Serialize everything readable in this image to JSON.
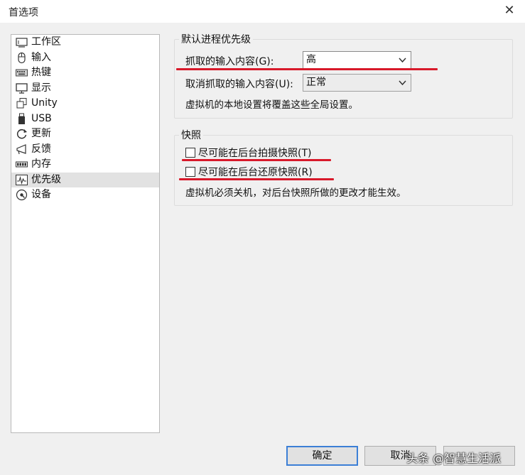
{
  "window": {
    "title": "首选项"
  },
  "sidebar": {
    "items": [
      {
        "label": "工作区",
        "icon": "workspace-icon"
      },
      {
        "label": "输入",
        "icon": "mouse-icon"
      },
      {
        "label": "热键",
        "icon": "keyboard-icon"
      },
      {
        "label": "显示",
        "icon": "monitor-icon"
      },
      {
        "label": "Unity",
        "icon": "unity-icon"
      },
      {
        "label": "USB",
        "icon": "usb-icon"
      },
      {
        "label": "更新",
        "icon": "update-icon"
      },
      {
        "label": "反馈",
        "icon": "feedback-icon"
      },
      {
        "label": "内存",
        "icon": "memory-icon"
      },
      {
        "label": "优先级",
        "icon": "priority-icon"
      },
      {
        "label": "设备",
        "icon": "device-icon"
      }
    ],
    "selected": "优先级"
  },
  "priority": {
    "legend": "默认进程优先级",
    "grabbed_label": "抓取的输入内容(G):",
    "grabbed_value": "高",
    "ungrabbed_label": "取消抓取的输入内容(U):",
    "ungrabbed_value": "正常",
    "note": "虚拟机的本地设置将覆盖这些全局设置。"
  },
  "snapshot": {
    "legend": "快照",
    "take_label": "尽可能在后台拍摄快照(T)",
    "take_checked": false,
    "restore_label": "尽可能在后台还原快照(R)",
    "restore_checked": false,
    "note": "虚拟机必须关机，对后台快照所做的更改才能生效。"
  },
  "buttons": {
    "ok": "确定",
    "cancel": "取消"
  },
  "watermark": "头条 @智慧生活派",
  "annotation_color": "#d8192a"
}
